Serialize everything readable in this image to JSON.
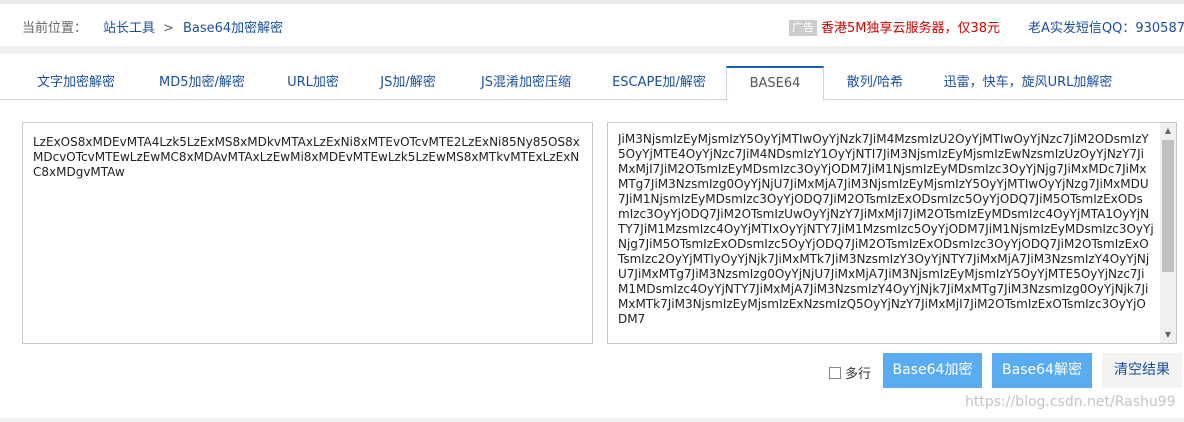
{
  "breadcrumb": {
    "prefix": "当前位置：",
    "tools": "站长工具",
    "separator": ">",
    "current": "Base64加密解密"
  },
  "ad": {
    "tag": "广告",
    "text": "香港5M独享云服务器，仅38元"
  },
  "contact": "老A实发短信QQ：930587",
  "tabs": [
    {
      "label": "文字加密解密"
    },
    {
      "label": "MD5加密/解密"
    },
    {
      "label": "URL加密"
    },
    {
      "label": "JS加/解密"
    },
    {
      "label": "JS混淆加密压缩"
    },
    {
      "label": "ESCAPE加/解密"
    },
    {
      "label": "BASE64",
      "active": true
    },
    {
      "label": "散列/哈希"
    },
    {
      "label": "迅雷，快车，旋风URL加解密"
    }
  ],
  "input_text": "LzExOS8xMDEvMTA4Lzk5LzExMS8xMDkvMTAxLzExNi8xMTEvOTcvMTE2LzExNi85Ny85OS8xMDcvOTcvMTEwLzEwMC8xMDAvMTAxLzEwMi8xMDEvMTEwLzk5LzEwMS8xMTkvMTExLzExNC8xMDgvMTAw",
  "output_text": "JiM3NjsmIzEyMjsmIzY5OyYjMTIwOyYjNzk7JiM4MzsmIzU2OyYjMTIwOyYjNzc7JiM2ODsmIzY5OyYjMTE4OyYjNzc7JiM4NDsmIzY1OyYjNTI7JiM3NjsmIzEyMjsmIzEwNzsmIzUzOyYjNzY7JiMxMjI7JiM2OTsmIzEyMDsmIzc3OyYjODM7JiM1NjsmIzEyMDsmIzc3OyYjNjg7JiMxMDc7JiMxMTg7JiM3NzsmIzg0OyYjNjU7JiMxMjA7JiM3NjsmIzEyMjsmIzY5OyYjMTIwOyYjNzg7JiMxMDU7JiM1NjsmIzEyMDsmIzc3OyYjODQ7JiM2OTsmIzExODsmIzc5OyYjODQ7JiM5OTsmIzExODsmIzc3OyYjODQ7JiM2OTsmIzUwOyYjNzY7JiMxMjI7JiM2OTsmIzEyMDsmIzc4OyYjMTA1OyYjNTY7JiM1MzsmIzc4OyYjMTIxOyYjNTY7JiM1MzsmIzc5OyYjODM7JiM1NjsmIzEyMDsmIzc3OyYjNjg7JiM5OTsmIzExODsmIzc5OyYjODQ7JiM2OTsmIzExODsmIzc3OyYjODQ7JiM2OTsmIzExOTsmIzc2OyYjMTIyOyYjNjk7JiMxMTk7JiM3NzsmIzY3OyYjNTY7JiMxMjA7JiM3NzsmIzY4OyYjNjU7JiMxMTg7JiM3NzsmIzg0OyYjNjU7JiMxMjA7JiM3NjsmIzEyMjsmIzY5OyYjMTE5OyYjNzc7JiM1MDsmIzc4OyYjNTY7JiMxMjA7JiM3NzsmIzY4OyYjNjk7JiMxMTg7JiM3NzsmIzg0OyYjNjk7JiMxMTk7JiM3NjsmIzEyMjsmIzExNzsmIzQ5OyYjNzY7JiMxMjI7JiM2OTsmIzExOTsmIzc3OyYjODM7",
  "options": {
    "multiline_label": "多行",
    "multiline_checked": false
  },
  "buttons": {
    "encode": "Base64加密",
    "decode": "Base64解密",
    "clear": "清空结果"
  },
  "watermark": "https://blog.csdn.net/Rashu99",
  "colors": {
    "link": "#1a4e9d",
    "ad_red": "#d40000",
    "button_blue": "#5aacf0",
    "active_tab_border": "#1d5fb4"
  }
}
